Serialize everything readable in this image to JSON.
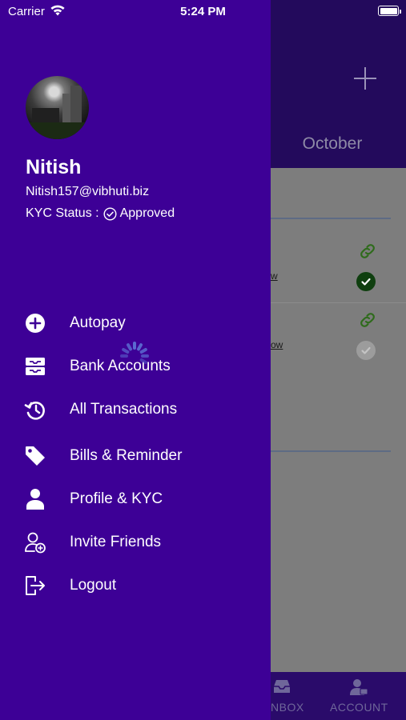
{
  "status_bar": {
    "carrier": "Carrier",
    "time": "5:24 PM"
  },
  "background": {
    "header": {
      "month": "October"
    },
    "rows": [
      {
        "link_fragment": "w",
        "status": "approved"
      },
      {
        "link_fragment": "ow",
        "status": "pending"
      }
    ],
    "tabbar": {
      "tabs": [
        {
          "label": "NBOX",
          "icon": "inbox-icon"
        },
        {
          "label": "ACCOUNT",
          "icon": "account-icon"
        }
      ]
    },
    "colors": {
      "header": "#230a5c",
      "link_icon": "#2f6b1c",
      "check_ok": "#0f3f0f",
      "check_pending": "#9c9c9c"
    }
  },
  "drawer": {
    "user": {
      "name": "Nitish",
      "email": "Nitish157@vibhuti.biz",
      "kyc_label": "KYC Status :",
      "kyc_value": "Approved"
    },
    "menu": [
      {
        "label": "Autopay",
        "icon": "plus-circle-icon"
      },
      {
        "label": "Bank Accounts",
        "icon": "bank-tray-icon"
      },
      {
        "label": "All Transactions",
        "icon": "history-icon"
      },
      {
        "label": "Bills & Reminder",
        "icon": "tag-icon"
      },
      {
        "label": "Profile & KYC",
        "icon": "person-icon"
      },
      {
        "label": "Invite Friends",
        "icon": "add-user-icon"
      },
      {
        "label": "Logout",
        "icon": "logout-icon"
      }
    ],
    "colors": {
      "background": "#3d0096",
      "text": "#ffffff"
    }
  }
}
